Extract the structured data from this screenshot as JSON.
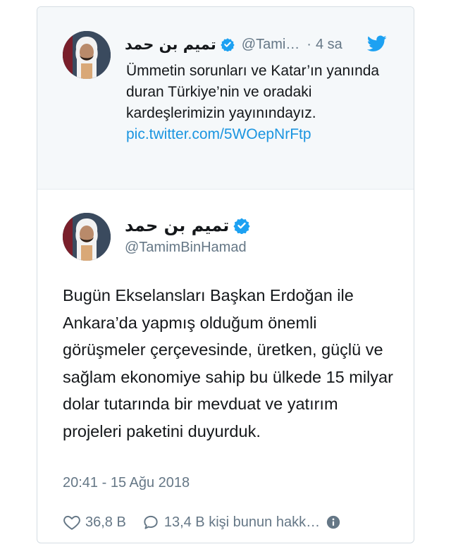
{
  "quoted_tweet": {
    "author_name": "تميم بن حمد",
    "handle": "@Tami…",
    "separator": "·",
    "time": "4 sa",
    "text": "Ümmetin sorunları ve Katar’ın yanında duran Türkiye’nin ve oradaki kardeşlerimizin yayınındayız.",
    "link": "pic.twitter.com/5WOepNrFtp"
  },
  "main_tweet": {
    "author_name": "تميم بن حمد",
    "handle": "@TamimBinHamad",
    "text": "Bugün Ekselansları Başkan Erdoğan ile Ankara’da yapmış olduğum önemli görüşmeler çerçevesinde, üretken, güçlü ve sağlam ekonomiye sahip bu ülkede 15 milyar dolar tutarında bir mevduat ve yatırım projeleri paketini duyurduk.",
    "timestamp": "20:41 - 15 Ağu 2018"
  },
  "actions": {
    "likes": "36,8 B",
    "replies": "13,4 B kişi bunun hakk…"
  },
  "icons": {
    "verified": "verified-badge-icon",
    "twitter": "twitter-bird-icon",
    "like": "heart-icon",
    "reply": "speech-bubble-icon",
    "info": "info-icon"
  },
  "colors": {
    "brand_blue": "#1da1f2",
    "link_blue": "#1b95e0",
    "text": "#14171a",
    "muted": "#657786",
    "quoted_bg": "#f5f8fa"
  }
}
